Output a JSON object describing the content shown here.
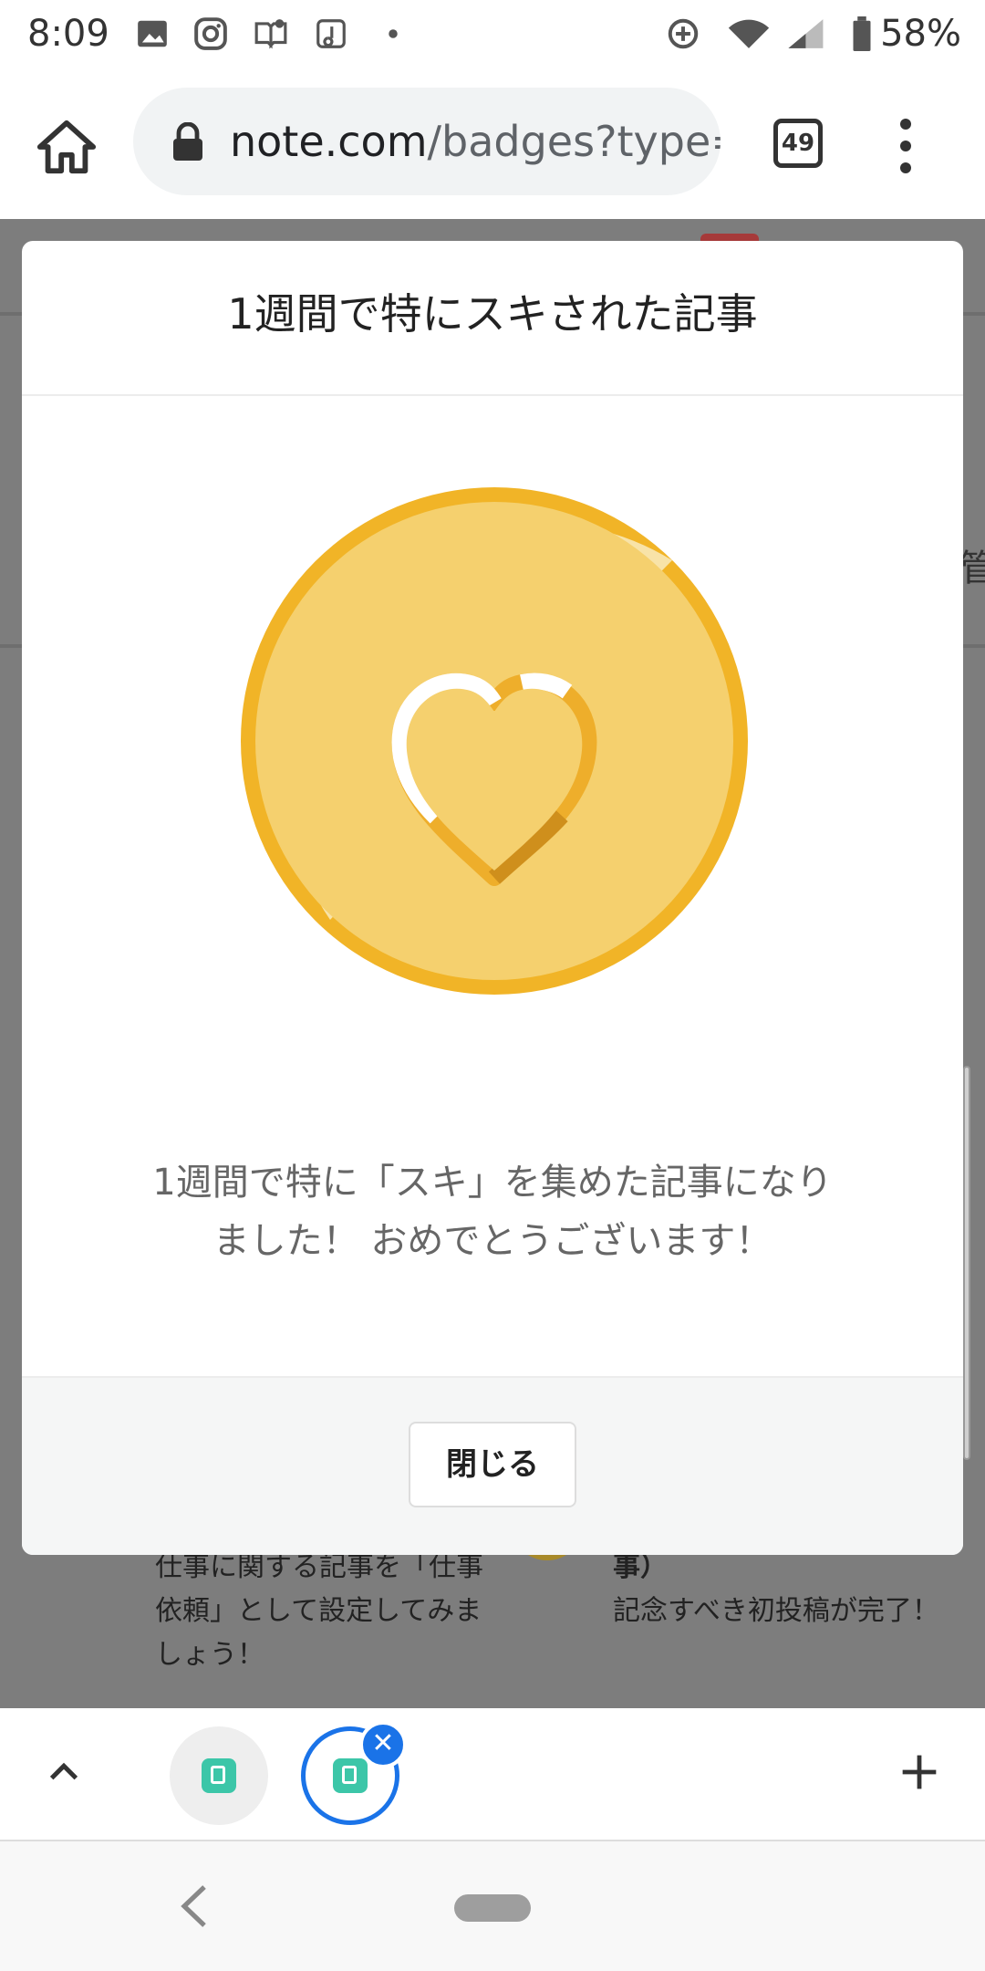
{
  "status_bar": {
    "time": "8:09",
    "battery": "58%",
    "icons": [
      "image-icon",
      "instagram-icon",
      "notification-icon",
      "app-icon",
      "dot-icon",
      "data-saver-icon",
      "wifi-icon",
      "signal-icon",
      "battery-icon"
    ]
  },
  "browser": {
    "url_host": "note.com",
    "url_path": "/badges?type=",
    "tab_count": "49"
  },
  "background_page": {
    "side_char": "管",
    "left_text": "仕事に関する記事を「仕事依頼」として設定してみましょう！",
    "right_text_top": "事）",
    "right_text": "記念すべき初投稿が完了！"
  },
  "modal": {
    "title": "1週間で特にスキされた記事",
    "message_line1": "1週間で特に「スキ」を集めた記事になり",
    "message_line2": "ました！ おめでとうございます！",
    "close_label": "閉じる",
    "badge_colors": {
      "face": "#f5d06e",
      "rim_dark": "#f1b427",
      "rim_light": "#f8e3a8",
      "heart_outline_light": "#ffffff",
      "heart_outline_mid": "#eeae2b",
      "heart_outline_dark": "#cf8f1c"
    }
  },
  "tab_strip": {
    "close_symbol": "✕"
  }
}
